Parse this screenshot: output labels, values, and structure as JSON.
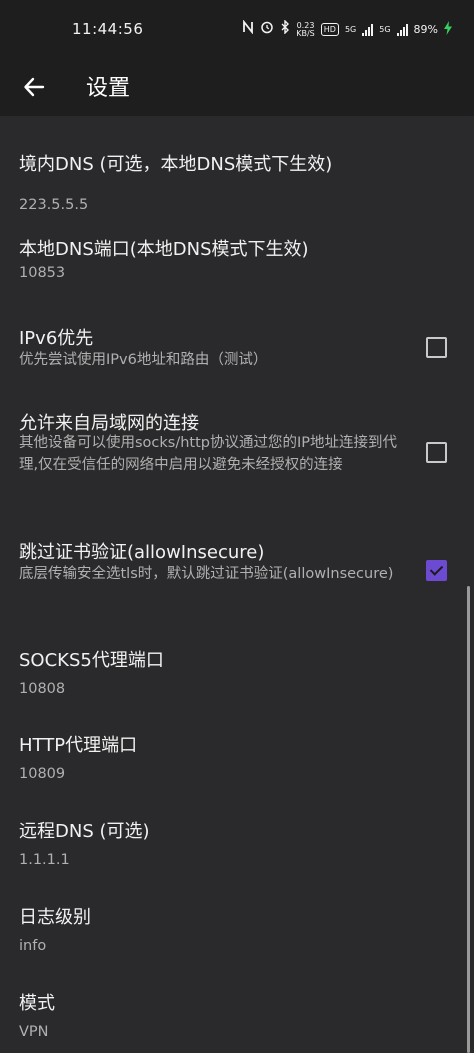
{
  "status_bar": {
    "time": "11:44:56",
    "speed_value": "0.23",
    "speed_unit": "KB/S",
    "hd_label": "HD",
    "net1": "5G",
    "net2": "5G",
    "battery": "89%"
  },
  "app_bar": {
    "title": "设置"
  },
  "prefs": [
    {
      "title": "境内DNS (可选，本地DNS模式下生效)",
      "summary": "223.5.5.5"
    },
    {
      "title": "本地DNS端口(本地DNS模式下生效)",
      "summary": "10853"
    },
    {
      "title": "IPv6优先",
      "summary": "优先尝试使用IPv6地址和路由（测试）",
      "checked": false
    },
    {
      "title": "允许来自局域网的连接",
      "summary": "其他设备可以使用socks/http协议通过您的IP地址连接到代理,仅在受信任的网络中启用以避免未经授权的连接",
      "checked": false
    },
    {
      "title": "跳过证书验证(allowInsecure)",
      "summary": "底层传输安全选tls时，默认跳过证书验证(allowInsecure)",
      "checked": true
    },
    {
      "title": "SOCKS5代理端口",
      "summary": "10808"
    },
    {
      "title": "HTTP代理端口",
      "summary": "10809"
    },
    {
      "title": "远程DNS (可选)",
      "summary": "1.1.1.1"
    },
    {
      "title": "日志级别",
      "summary": "info"
    },
    {
      "title": "模式",
      "summary": "VPN"
    }
  ],
  "icons": {
    "back": "arrow-left-icon",
    "nfc": "nfc-icon",
    "alarm": "alarm-icon",
    "bluetooth": "bluetooth-icon",
    "charging": "charging-bolt-icon"
  },
  "colors": {
    "background": "#2a2a2c",
    "bar": "#1e1e1e",
    "accent": "#6c4bd2",
    "charging": "#37d05f"
  }
}
